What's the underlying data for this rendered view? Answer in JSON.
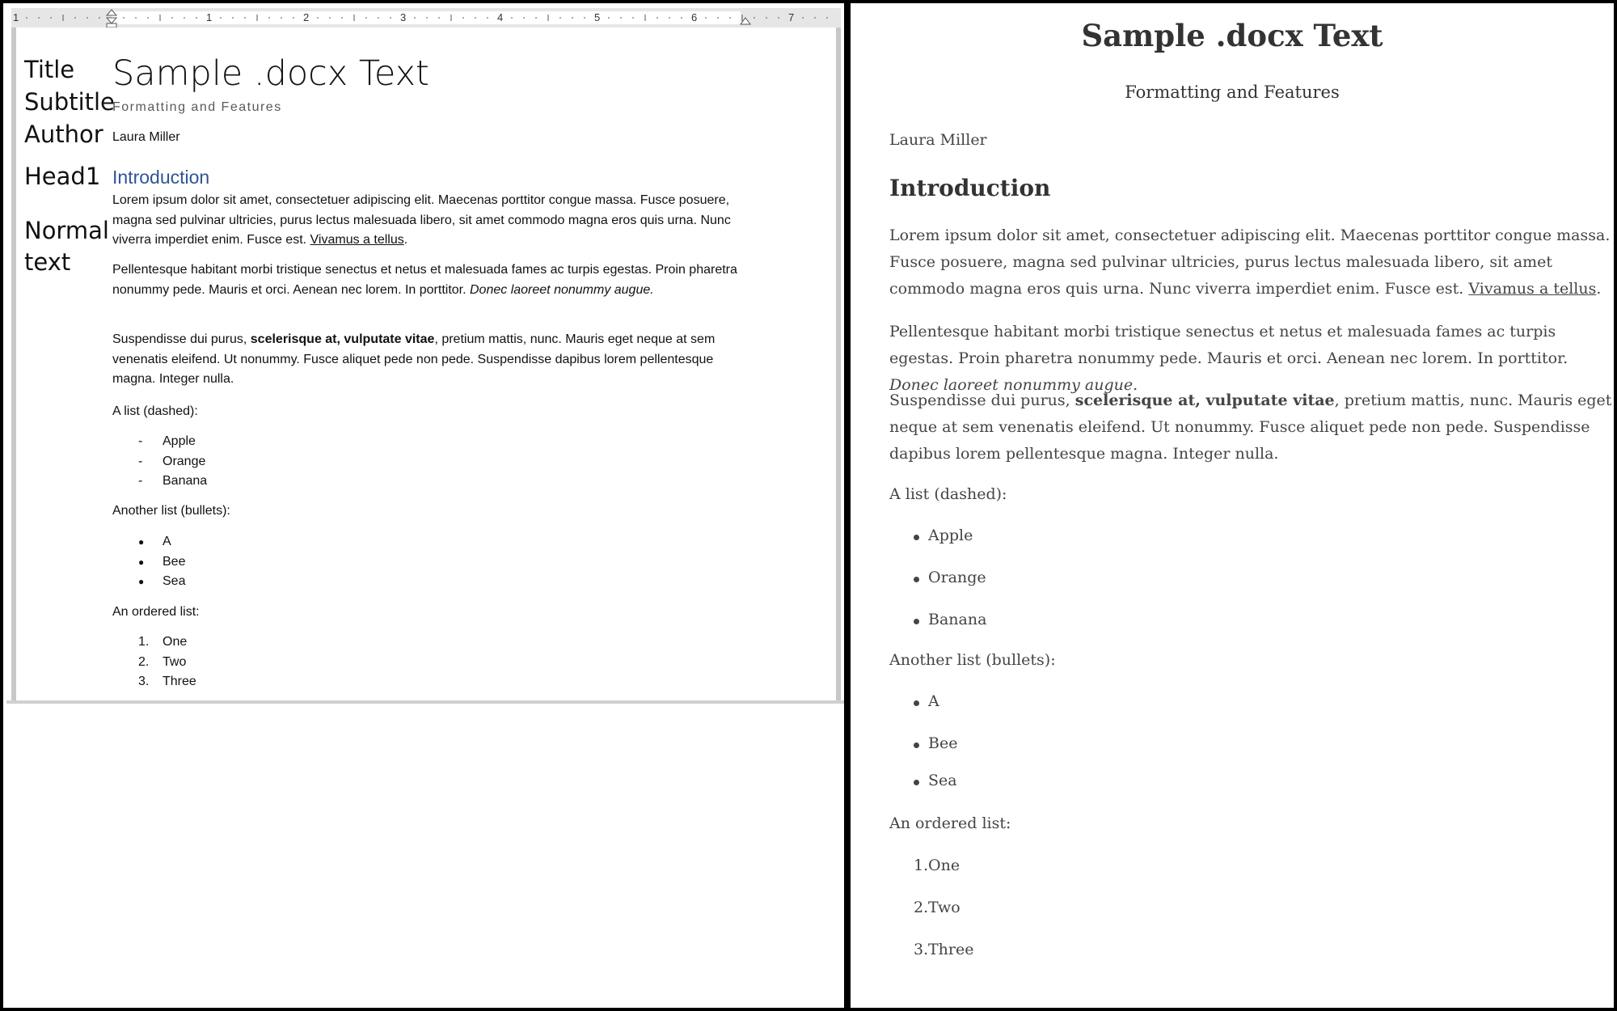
{
  "word": {
    "ruler": {
      "numbers": [
        "1",
        "1",
        "2",
        "3",
        "4",
        "5",
        "6",
        "7"
      ]
    },
    "style_labels": [
      "Title",
      "Subtitle",
      "Author",
      "Head1",
      "Normal",
      "text"
    ],
    "title": "Sample .docx Text",
    "subtitle": "Formatting and Features",
    "author": "Laura Miller",
    "heading1": "Introduction",
    "p1_text": "Lorem ipsum dolor sit amet, consectetuer adipiscing elit. Maecenas porttitor congue massa. Fusce posuere, magna sed pulvinar ultricies, purus lectus malesuada libero, sit amet commodo magna eros quis urna. Nunc viverra imperdiet enim. Fusce est. ",
    "p1_link": "Vivamus a tellus",
    "p1_end": ".",
    "p2_text": "Pellentesque habitant morbi tristique senectus et netus et malesuada fames ac turpis egestas. Proin pharetra nonummy pede. Mauris et orci. Aenean nec lorem. In porttitor. ",
    "p2_italic": "Donec laoreet nonummy augue.",
    "p3_start": "Suspendisse dui purus, ",
    "p3_bold": "scelerisque at, vulputate vitae",
    "p3_end": ", pretium mattis, nunc. Mauris eget neque at sem venenatis eleifend. Ut nonummy. Fusce aliquet pede non pede. Suspendisse dapibus lorem pellentesque magna. Integer nulla.",
    "list1_label": "A list (dashed):",
    "list1": [
      {
        "marker": "-",
        "text": "Apple"
      },
      {
        "marker": "-",
        "text": "Orange"
      },
      {
        "marker": "-",
        "text": "Banana"
      }
    ],
    "list2_label": "Another list (bullets):",
    "list2": [
      {
        "marker": "●",
        "text": "A"
      },
      {
        "marker": "●",
        "text": "Bee"
      },
      {
        "marker": "●",
        "text": "Sea"
      }
    ],
    "list3_label": "An ordered list:",
    "list3": [
      {
        "marker": "1.",
        "text": "One"
      },
      {
        "marker": "2.",
        "text": "Two"
      },
      {
        "marker": "3.",
        "text": "Three"
      }
    ]
  },
  "preview": {
    "title": "Sample .docx Text",
    "subtitle": "Formatting and Features",
    "author": "Laura Miller",
    "heading1": "Introduction",
    "p1_text": "Lorem ipsum dolor sit amet, consectetuer adipiscing elit. Maecenas porttitor congue massa. Fusce posuere, magna sed pulvinar ultricies, purus lectus malesuada libero, sit amet commodo magna eros quis urna. Nunc viverra imperdiet enim. Fusce est. ",
    "p1_link": "Vivamus a tellus",
    "p1_end": ".",
    "p2_text": "Pellentesque habitant morbi tristique senectus et netus et malesuada fames ac turpis egestas. Proin pharetra nonummy pede. Mauris et orci. Aenean nec lorem. In porttitor. ",
    "p2_italic": "Donec laoreet nonummy augue.",
    "p3_start": "Suspendisse dui purus, ",
    "p3_bold": "scelerisque at, vulputate vitae",
    "p3_end": ", pretium mattis, nunc. Mauris eget neque at sem venenatis eleifend. Ut nonummy. Fusce aliquet pede non pede. Suspendisse dapibus lorem pellentesque magna. Integer nulla.",
    "list1_label": "A list (dashed):",
    "list1": [
      "Apple",
      "Orange",
      "Banana"
    ],
    "list2_label": "Another list (bullets):",
    "list2": [
      "A",
      "Bee",
      "Sea"
    ],
    "list3_label": "An ordered list:",
    "list3": [
      {
        "marker": "1.",
        "text": "One"
      },
      {
        "marker": "2.",
        "text": "Two"
      },
      {
        "marker": "3.",
        "text": "Three"
      }
    ]
  }
}
